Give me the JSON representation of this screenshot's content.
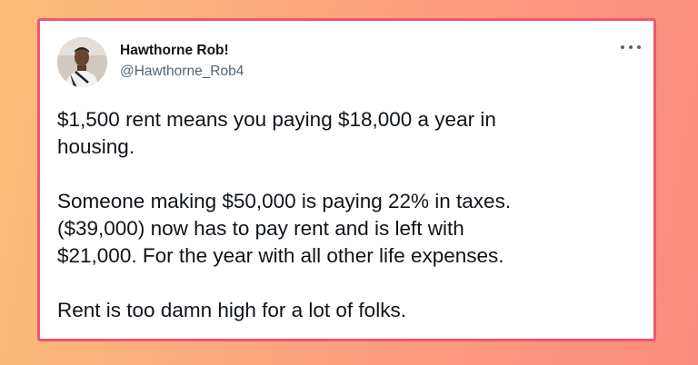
{
  "tweet": {
    "author": {
      "display_name": "Hawthorne Rob!",
      "handle": "@Hawthorne_Rob4",
      "avatar_icon": "profile-photo"
    },
    "more_icon": "more-horizontal-icon",
    "paragraphs": [
      "$1,500 rent means you paying $18,000 a year in\nhousing.",
      "Someone making $50,000 is paying 22% in taxes.\n($39,000) now has to pay rent and is left with\n$21,000. For the year with all other life expenses.",
      "Rent is too damn high for a lot of folks."
    ]
  },
  "colors": {
    "card_border": "#f0566d",
    "background_start": "#fdbd77",
    "background_end": "#fb8a7e",
    "text_primary": "#0f1419",
    "text_secondary": "#536471"
  }
}
